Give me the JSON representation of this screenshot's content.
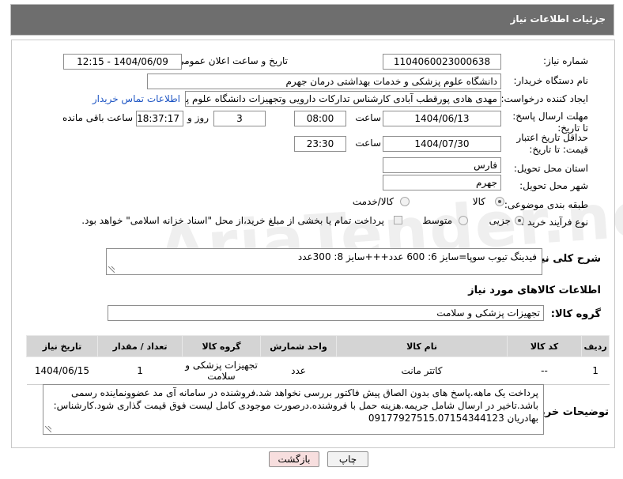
{
  "header": {
    "title": "جزئیات اطلاعات نیاز"
  },
  "form": {
    "need_number_label": "شماره نیاز:",
    "need_number": "1104060023000638",
    "announce_label": "تاریخ و ساعت اعلان عمومی:",
    "announce_value": "1404/06/09 - 12:15",
    "buyer_org_label": "نام دستگاه خریدار:",
    "buyer_org": "دانشگاه علوم پزشکی و خدمات بهداشتی  درمان جهرم",
    "creator_label": "ایجاد کننده درخواست:",
    "creator": "مهدی هادی پورقطب آبادی کارشناس تدارکات دارویی وتجهیزات دانشگاه علوم پز",
    "contact_link": "اطلاعات تماس خریدار",
    "deadline_label": "مهلت ارسال پاسخ: تا تاریخ:",
    "deadline_date": "1404/06/13",
    "time_label": "ساعت",
    "deadline_time": "08:00",
    "days": "3",
    "days_label": "روز و",
    "remaining": "18:37:17",
    "remaining_label": "ساعت باقی مانده",
    "validity_label": "حداقل تاریخ اعتبار قیمت: تا تاریخ:",
    "validity_date": "1404/07/30",
    "validity_time": "23:30",
    "province_label": "استان محل تحویل:",
    "province": "فارس",
    "city_label": "شهر محل تحویل:",
    "city": "جهرم",
    "category_label": "طبقه بندی موضوعی:",
    "category_options": [
      "کالا",
      "کالا/خدمت"
    ],
    "process_label": "نوع فرآیند خرید :",
    "process_options": [
      "جزیی",
      "متوسط"
    ],
    "payment_note": "پرداخت تمام یا بخشی از مبلغ خرید،از محل \"اسناد خزانه اسلامی\" خواهد بود."
  },
  "description": {
    "label": "شرح کلی نیاز:",
    "text": "فیدینگ تیوب سوپا=سایز 6: 600 عدد+++سایز 8: 300عدد"
  },
  "goods": {
    "section_title": "اطلاعات کالاهای مورد نیاز",
    "group_label": "گروه کالا:",
    "group_value": "تجهیزات پزشکی و سلامت",
    "columns": [
      "ردیف",
      "کد کالا",
      "نام کالا",
      "واحد شمارش",
      "گروه کالا",
      "تعداد / مقدار",
      "تاریخ نیاز"
    ],
    "rows": [
      [
        "1",
        "--",
        "کاتتر مانت",
        "عدد",
        "تجهیزات پزشکی و سلامت",
        "1",
        "1404/06/15"
      ]
    ]
  },
  "buyer_notes": {
    "label": "توضیحات خریدار:",
    "text": "پرداخت یک ماهه.پاسخ های بدون الصاق پیش فاکتور بررسی نخواهد شد.فروشنده در سامانه آی مد عضوونماینده رسمی باشد.تاخیر در ارسال شامل جریمه.هزینه حمل با فروشنده.درصورت موجودی کامل لیست فوق قیمت گذاری شود.کارشناس: بهادریان 09177927515.07154344123"
  },
  "buttons": {
    "print": "چاپ",
    "back": "بازگشت"
  },
  "watermark": "AriaTender.neT",
  "colors": {
    "header_bg": "#6e6e6e",
    "link": "#1f56c4",
    "back_button_bg": "#f7dede",
    "print_button_bg": "#f2f2f2"
  }
}
